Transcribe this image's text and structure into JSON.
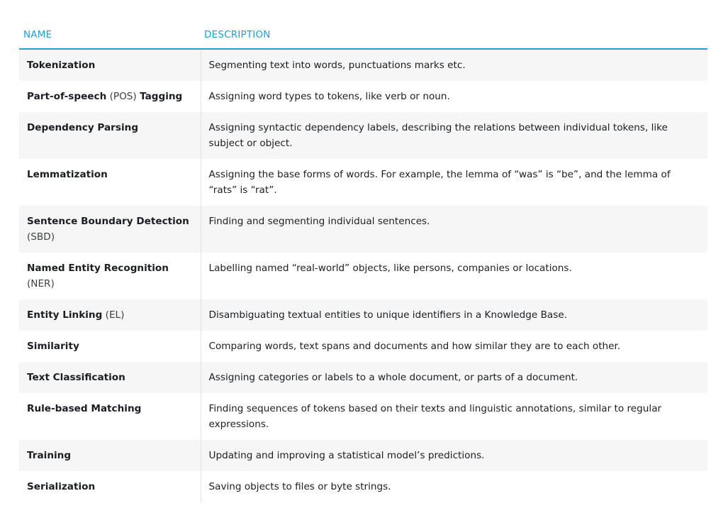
{
  "table": {
    "headers": {
      "name": "NAME",
      "description": "DESCRIPTION"
    },
    "rows": [
      {
        "name_bold": "Tokenization",
        "abbr": "",
        "name_bold2": "",
        "description": "Segmenting text into words, punctuations marks etc."
      },
      {
        "name_bold": "Part-of-speech",
        "abbr": " (POS) ",
        "name_bold2": "Tagging",
        "description": "Assigning word types to tokens, like verb or noun."
      },
      {
        "name_bold": "Dependency Parsing",
        "abbr": "",
        "name_bold2": "",
        "description": "Assigning syntactic dependency labels, describing the relations between individual tokens, like subject or object."
      },
      {
        "name_bold": "Lemmatization",
        "abbr": "",
        "name_bold2": "",
        "description": "Assigning the base forms of words. For example, the lemma of “was” is “be”, and the lemma of “rats” is “rat”."
      },
      {
        "name_bold": "Sentence Boundary Detection",
        "abbr": " (SBD)",
        "name_bold2": "",
        "description": "Finding and segmenting individual sentences."
      },
      {
        "name_bold": "Named Entity Recognition",
        "abbr": " (NER)",
        "name_bold2": "",
        "description": "Labelling named “real-world” objects, like persons, companies or locations."
      },
      {
        "name_bold": "Entity Linking",
        "abbr": " (EL)",
        "name_bold2": "",
        "description": "Disambiguating textual entities to unique identifiers in a Knowledge Base."
      },
      {
        "name_bold": "Similarity",
        "abbr": "",
        "name_bold2": "",
        "description": "Comparing words, text spans and documents and how similar they are to each other."
      },
      {
        "name_bold": "Text Classification",
        "abbr": "",
        "name_bold2": "",
        "description": "Assigning categories or labels to a whole document, or parts of a document."
      },
      {
        "name_bold": "Rule-based Matching",
        "abbr": "",
        "name_bold2": "",
        "description": "Finding sequences of tokens based on their texts and linguistic annotations, similar to regular expressions."
      },
      {
        "name_bold": "Training",
        "abbr": "",
        "name_bold2": "",
        "description": "Updating and improving a statistical model’s predictions."
      },
      {
        "name_bold": "Serialization",
        "abbr": "",
        "name_bold2": "",
        "description": "Saving objects to files or byte strings."
      }
    ]
  }
}
